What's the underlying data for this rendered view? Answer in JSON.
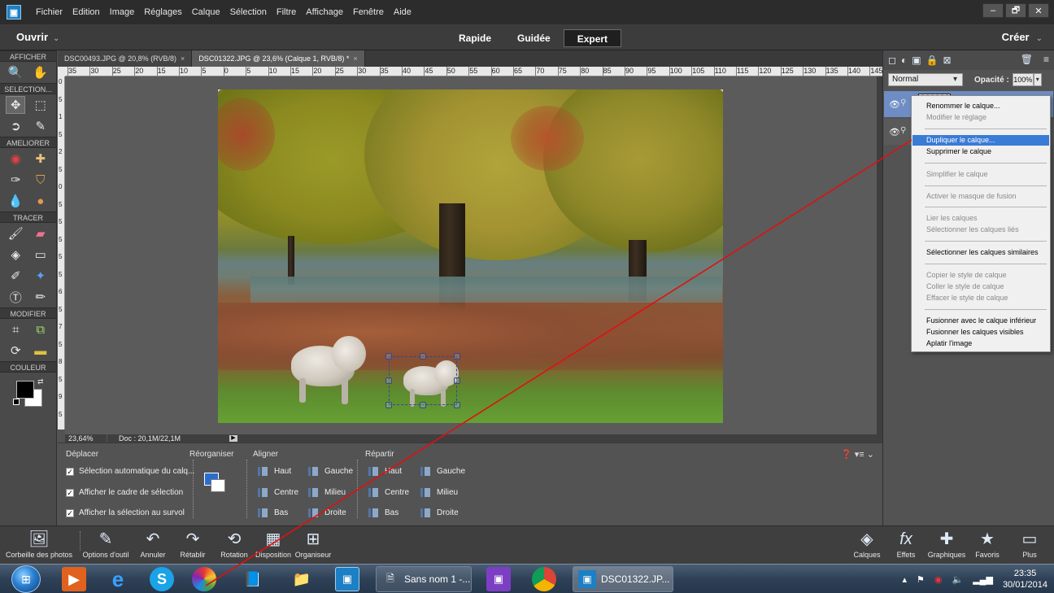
{
  "menubar": {
    "items": [
      "Fichier",
      "Edition",
      "Image",
      "Réglages",
      "Calque",
      "Sélection",
      "Filtre",
      "Affichage",
      "Fenêtre",
      "Aide"
    ],
    "window_controls": [
      "–",
      "🗗",
      "✕"
    ]
  },
  "modebar": {
    "open_label": "Ouvrir",
    "modes": [
      "Rapide",
      "Guidée",
      "Expert"
    ],
    "active_mode": "Expert",
    "create_label": "Créer"
  },
  "toolbox": {
    "sections": [
      "AFFICHER",
      "SELECTION...",
      "AMELIORER",
      "TRACER",
      "MODIFIER",
      "COULEUR"
    ]
  },
  "doc_tabs": [
    {
      "label": "DSC00493.JPG @ 20,8% (RVB/8)",
      "close": "×"
    },
    {
      "label": "DSC01322.JPG @ 23,6% (Calque 1, RVB/8) *",
      "close": "×"
    }
  ],
  "ruler": {
    "h_ticks": [
      "35",
      "30",
      "25",
      "20",
      "15",
      "10",
      "5",
      "0",
      "5",
      "10",
      "15",
      "20",
      "25",
      "30",
      "35",
      "40",
      "45",
      "50",
      "55",
      "60",
      "65",
      "70",
      "75",
      "80",
      "85",
      "90",
      "95",
      "100",
      "105",
      "110",
      "115",
      "120",
      "125",
      "130",
      "135",
      "140",
      "145"
    ],
    "v_ticks": [
      "0",
      "5",
      "1",
      "5",
      "2",
      "5",
      "0",
      "5",
      "5",
      "5",
      "5",
      "5",
      "6",
      "5",
      "7",
      "5",
      "8",
      "5",
      "9",
      "5"
    ]
  },
  "status": {
    "zoom": "23,64%",
    "doc": "Doc : 20,1M/22,1M",
    "arrow": "▶"
  },
  "options": {
    "move_heading": "Déplacer",
    "reorganize_heading": "Réorganiser",
    "align_heading": "Aligner",
    "distribute_heading": "Répartir",
    "checks": [
      {
        "label": "Sélection automatique du calq...",
        "checked": "✓"
      },
      {
        "label": "Afficher le cadre de sélection",
        "checked": "✓"
      },
      {
        "label": "Afficher la sélection au survol",
        "checked": "✓"
      }
    ],
    "align": [
      "Haut",
      "Centre",
      "Bas",
      "Gauche",
      "Milieu",
      "Droite"
    ],
    "distribute": [
      "Haut",
      "Centre",
      "Bas",
      "Gauche",
      "Milieu",
      "Droite"
    ],
    "ctrls": "❓ ▾≡ ⌄"
  },
  "layers_panel": {
    "blend_mode": "Normal",
    "opacity_label": "Opacité :",
    "opacity_value": "100%"
  },
  "context_menu": {
    "items": [
      {
        "label": "Renommer le calque...",
        "state": "normal"
      },
      {
        "label": "Modifier le réglage",
        "state": "disabled"
      },
      {
        "label": "Dupliquer le calque...",
        "state": "highlight"
      },
      {
        "label": "Supprimer le calque",
        "state": "normal"
      },
      {
        "label": "Simplifier le calque",
        "state": "disabled"
      },
      {
        "label": "Activer le masque de fusion",
        "state": "disabled"
      },
      {
        "label": "Lier les calques",
        "state": "disabled"
      },
      {
        "label": "Sélectionner les calques liés",
        "state": "disabled"
      },
      {
        "label": "Sélectionner les calques similaires",
        "state": "normal"
      },
      {
        "label": "Copier le style de calque",
        "state": "disabled"
      },
      {
        "label": "Coller le style de calque",
        "state": "disabled"
      },
      {
        "label": "Effacer le style de calque",
        "state": "disabled"
      },
      {
        "label": "Fusionner avec le calque inférieur",
        "state": "normal"
      },
      {
        "label": "Fusionner les calques visibles",
        "state": "normal"
      },
      {
        "label": "Aplatir l'image",
        "state": "normal"
      }
    ]
  },
  "bottombar": {
    "left": [
      "Corbeille des photos",
      "Options d'outil",
      "Annuler",
      "Rétablir",
      "Rotation",
      "Disposition",
      "Organiseur"
    ],
    "right": [
      "Calques",
      "Effets",
      "Graphiques",
      "Favoris",
      "Plus"
    ]
  },
  "taskbar": {
    "windows": [
      "Sans nom 1 -...",
      "DSC01322.JP..."
    ],
    "time": "23:35",
    "date": "30/01/2014"
  },
  "colors": {
    "accent": "#3a7bd5",
    "annotation_line": "#e01010",
    "foreground": "#000000",
    "background": "#ffffff"
  }
}
